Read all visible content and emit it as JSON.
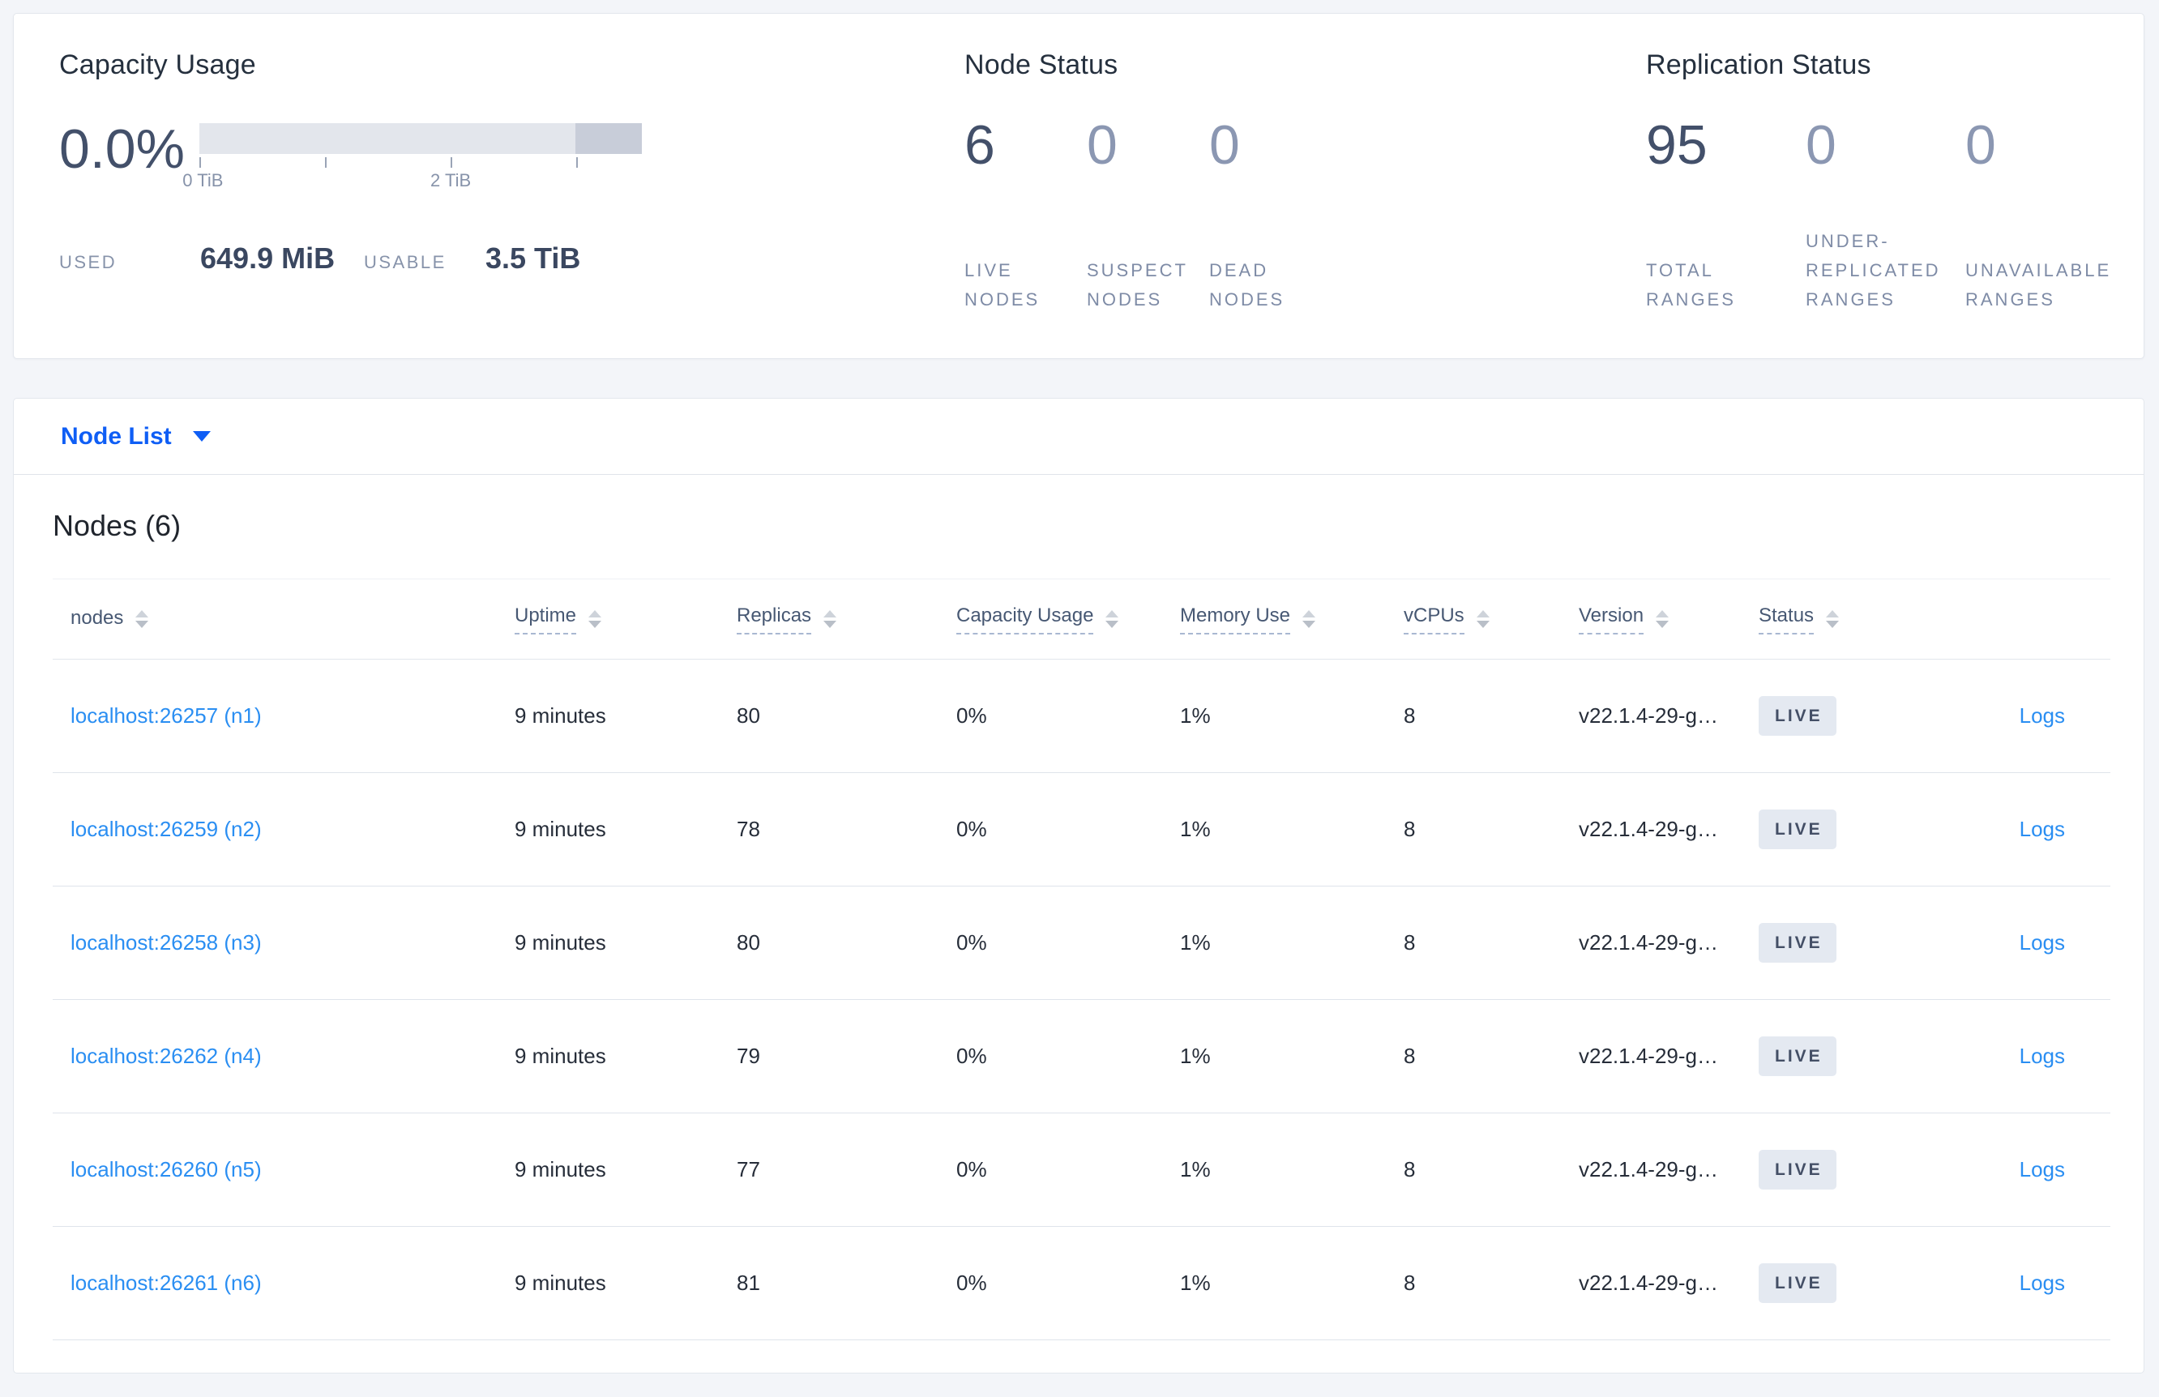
{
  "capacity": {
    "title": "Capacity Usage",
    "percent": "0.0%",
    "axis_label_0": "0 TiB",
    "axis_label_2": "2 TiB",
    "used_label": "USED",
    "used_value": "649.9 MiB",
    "usable_label": "USABLE",
    "usable_value": "3.5 TiB",
    "bar": {
      "track_color": "#e3e6ec",
      "other_color": "#c8cdd9",
      "ticks_tib": [
        0,
        1,
        2,
        3
      ],
      "usable_tib": 3.5
    }
  },
  "node_status": {
    "title": "Node Status",
    "stats": [
      {
        "value": "6",
        "label": "LIVE\nNODES"
      },
      {
        "value": "0",
        "label": "SUSPECT\nNODES"
      },
      {
        "value": "0",
        "label": "DEAD\nNODES"
      }
    ]
  },
  "replication_status": {
    "title": "Replication Status",
    "stats": [
      {
        "value": "95",
        "label": "TOTAL\nRANGES"
      },
      {
        "value": "0",
        "label": "UNDER-\nREPLICATED\nRANGES"
      },
      {
        "value": "0",
        "label": "UNAVAILABLE\nRANGES"
      }
    ]
  },
  "node_list": {
    "dropdown_label": "Node List",
    "heading": "Nodes (6)",
    "columns": [
      {
        "label": "nodes"
      },
      {
        "label": "Uptime"
      },
      {
        "label": "Replicas"
      },
      {
        "label": "Capacity Usage"
      },
      {
        "label": "Memory Use"
      },
      {
        "label": "vCPUs"
      },
      {
        "label": "Version"
      },
      {
        "label": "Status"
      }
    ],
    "rows": [
      {
        "node": "localhost:26257 (n1)",
        "uptime": "9 minutes",
        "replicas": "80",
        "capacity": "0%",
        "memory": "1%",
        "vcpus": "8",
        "version": "v22.1.4-29-g…",
        "status": "LIVE",
        "logs": "Logs"
      },
      {
        "node": "localhost:26259 (n2)",
        "uptime": "9 minutes",
        "replicas": "78",
        "capacity": "0%",
        "memory": "1%",
        "vcpus": "8",
        "version": "v22.1.4-29-g…",
        "status": "LIVE",
        "logs": "Logs"
      },
      {
        "node": "localhost:26258 (n3)",
        "uptime": "9 minutes",
        "replicas": "80",
        "capacity": "0%",
        "memory": "1%",
        "vcpus": "8",
        "version": "v22.1.4-29-g…",
        "status": "LIVE",
        "logs": "Logs"
      },
      {
        "node": "localhost:26262 (n4)",
        "uptime": "9 minutes",
        "replicas": "79",
        "capacity": "0%",
        "memory": "1%",
        "vcpus": "8",
        "version": "v22.1.4-29-g…",
        "status": "LIVE",
        "logs": "Logs"
      },
      {
        "node": "localhost:26260 (n5)",
        "uptime": "9 minutes",
        "replicas": "77",
        "capacity": "0%",
        "memory": "1%",
        "vcpus": "8",
        "version": "v22.1.4-29-g…",
        "status": "LIVE",
        "logs": "Logs"
      },
      {
        "node": "localhost:26261 (n6)",
        "uptime": "9 minutes",
        "replicas": "81",
        "capacity": "0%",
        "memory": "1%",
        "vcpus": "8",
        "version": "v22.1.4-29-g…",
        "status": "LIVE",
        "logs": "Logs"
      }
    ]
  },
  "colors": {
    "accent_blue": "#0f5ef5",
    "link_blue": "#2a8ef2",
    "primary_text": "#43506a",
    "muted_text": "#7e8ba6",
    "badge_bg": "#e4e9f1"
  }
}
